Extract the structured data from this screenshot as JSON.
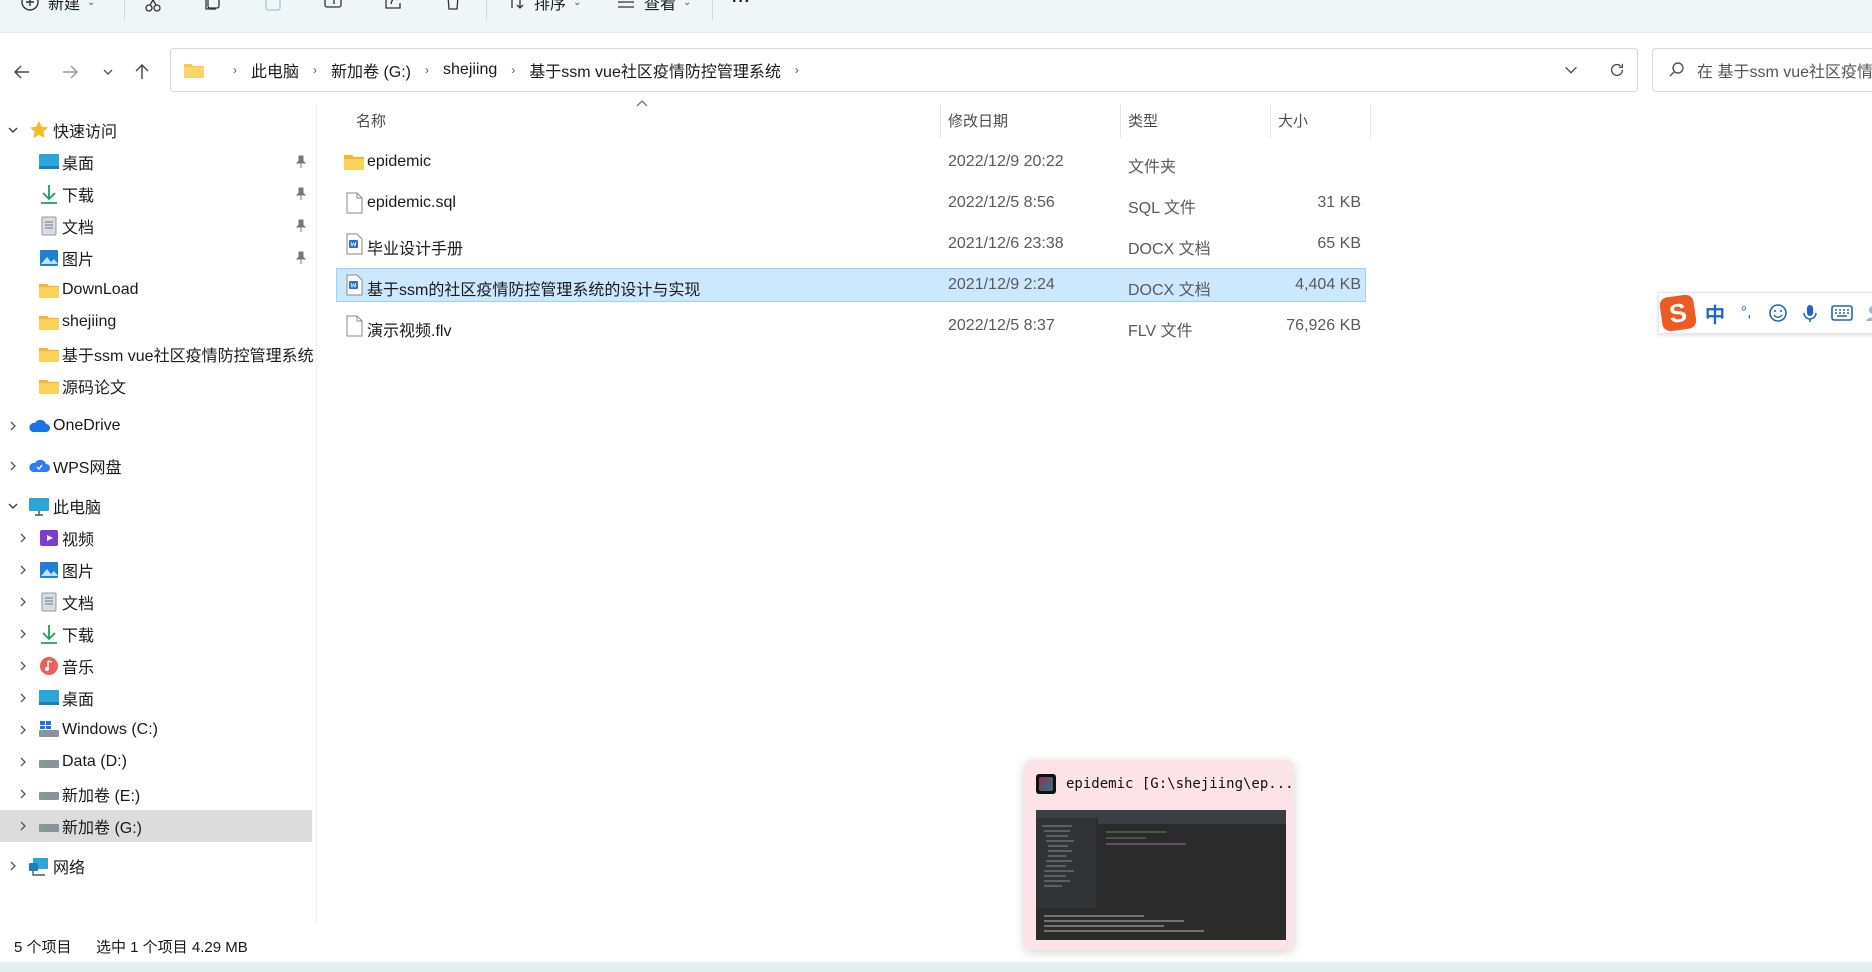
{
  "toolbar": {
    "new_label": "新建",
    "sort_label": "排序",
    "view_label": "查看",
    "more_label": "···"
  },
  "address": {
    "breadcrumbs": [
      "此电脑",
      "新加卷 (G:)",
      "shejiing",
      "基于ssm vue社区疫情防控管理系统"
    ],
    "search_placeholder": "在 基于ssm vue社区疫情防控管理系统 中搜索"
  },
  "nav": {
    "quick_access": "快速访问",
    "quick_items": [
      "桌面",
      "下载",
      "文档",
      "图片",
      "DownLoad",
      "shejiing",
      "基于ssm vue社区疫情防控管理系统",
      "源码论文"
    ],
    "onedrive": "OneDrive",
    "wps": "WPS网盘",
    "this_pc": "此电脑",
    "pc_items": [
      "视频",
      "图片",
      "文档",
      "下载",
      "音乐",
      "桌面",
      "Windows (C:)",
      "Data (D:)",
      "新加卷 (E:)",
      "新加卷 (G:)"
    ],
    "network": "网络"
  },
  "columns": {
    "name": "名称",
    "date": "修改日期",
    "type": "类型",
    "size": "大小"
  },
  "files": [
    {
      "name": "epidemic",
      "date": "2022/12/9 20:22",
      "type": "文件夹",
      "size": "",
      "icon": "folder-icon"
    },
    {
      "name": "epidemic.sql",
      "date": "2022/12/5 8:56",
      "type": "SQL 文件",
      "size": "31 KB",
      "icon": "file-icon"
    },
    {
      "name": "毕业设计手册",
      "date": "2021/12/6 23:38",
      "type": "DOCX 文档",
      "size": "65 KB",
      "icon": "docx-icon"
    },
    {
      "name": "基于ssm的社区疫情防控管理系统的设计与实现",
      "date": "2021/12/9 2:24",
      "type": "DOCX 文档",
      "size": "4,404 KB",
      "icon": "docx-icon"
    },
    {
      "name": "演示视频.flv",
      "date": "2022/12/5 8:37",
      "type": "FLV 文件",
      "size": "76,926 KB",
      "icon": "file-icon"
    }
  ],
  "selected_file_index": 3,
  "status": {
    "count": "5 个项目",
    "selected": "选中 1 个项目  4.29 MB"
  },
  "ime": {
    "mode": "中"
  },
  "thumbnail": {
    "title": "epidemic [G:\\shejiing\\ep..."
  },
  "colors": {
    "selection_bg": "#cce8ff",
    "selection_border": "#99d1ff",
    "folder": "#f8c84a",
    "accent": "#0067c0"
  }
}
